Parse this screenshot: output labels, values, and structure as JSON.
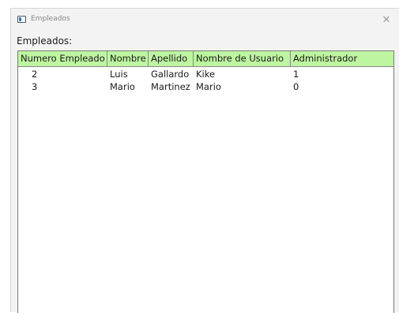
{
  "window": {
    "title": "Empleados",
    "close_glyph": "✕",
    "title_icon": "app-window-icon"
  },
  "main": {
    "section_label": "Empleados:"
  },
  "table": {
    "header_color": "#bdf5a0",
    "columns": [
      "Numero Empleado",
      "Nombre",
      "Apellido",
      "Nombre de Usuario",
      "Administrador"
    ],
    "rows": [
      [
        "2",
        "Luis",
        "Gallardo",
        "Kike",
        "1"
      ],
      [
        "3",
        "Mario",
        "Martinez",
        "Mario",
        "0"
      ]
    ]
  }
}
